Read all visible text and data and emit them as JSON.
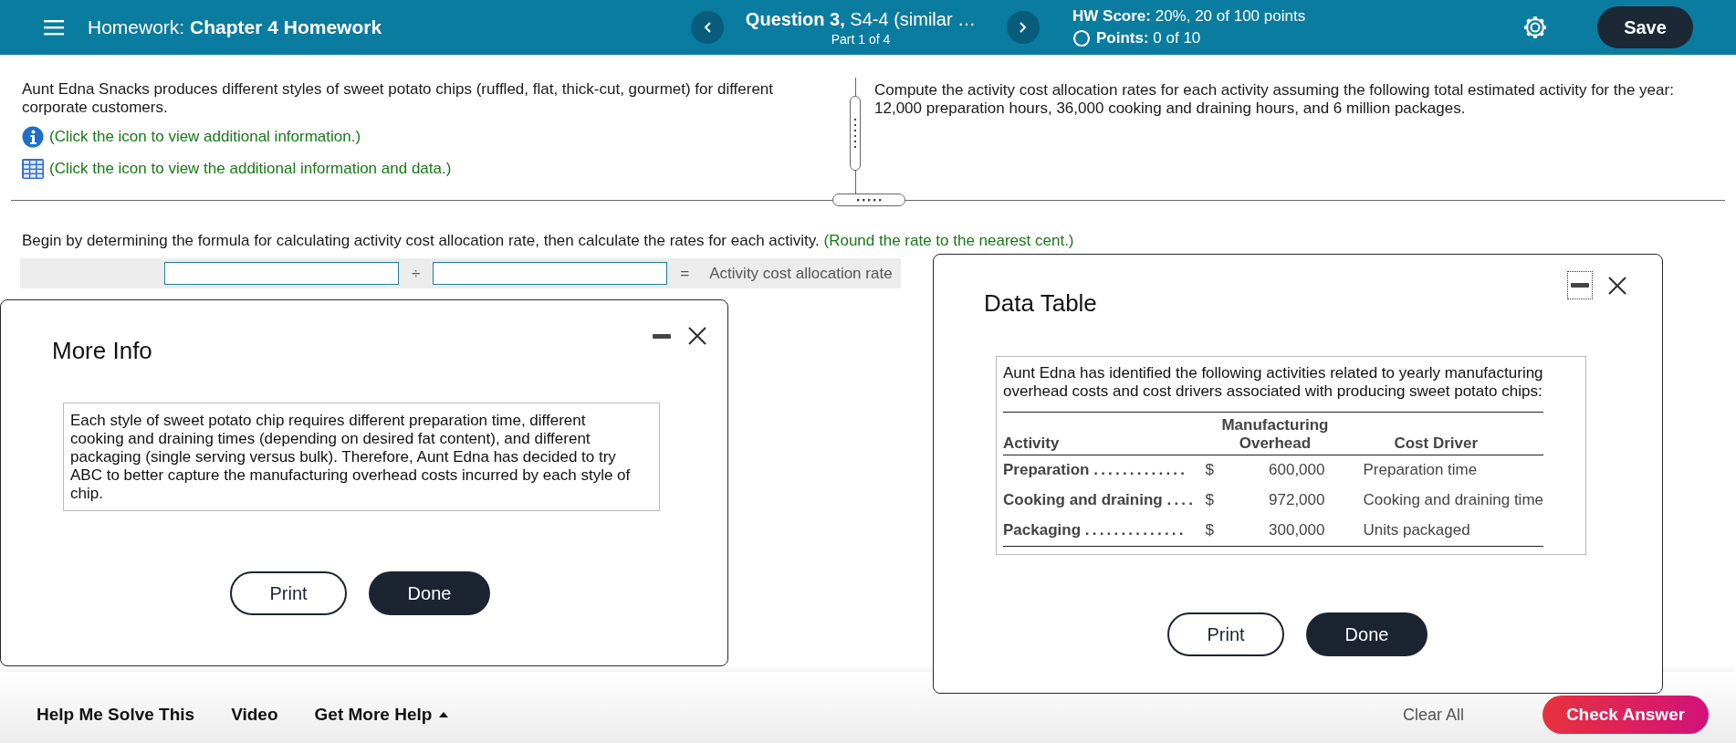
{
  "header": {
    "title_prefix": "Homework:",
    "title": "Chapter 4 Homework",
    "question": "**Question 3,** S4-4 (similar …",
    "part": "Part 1 of 4",
    "hw_score": "**HW Score:** 20%, 20 of 100 points",
    "points": "**Points:** 0 of 10",
    "save": "Save"
  },
  "problem": {
    "intro": "Aunt Edna Snacks produces different styles of sweet potato chips (ruffled, flat, thick-cut, gourmet) for different corporate customers.",
    "links": [
      {
        "kind": "info",
        "text": "(Click the icon to view additional information.)"
      },
      {
        "kind": "table",
        "text": "(Click the icon to view the additional information and data.)"
      }
    ],
    "right_text": "Compute the activity cost allocation rates for each activity assuming the following total estimated activity for the year: 12,000 preparation hours, 36,000 cooking and draining hours, and 6 million packages.",
    "instruction": "Begin by determining the formula for calculating activity cost allocation rate, then calculate the rates for each activity.",
    "hint": "(Round the rate to the nearest cent.)",
    "formula": [
      {
        "kind": "field"
      },
      {
        "kind": "symbol",
        "text": "÷"
      },
      {
        "kind": "field"
      },
      {
        "kind": "symbol",
        "text": "="
      },
      {
        "kind": "label",
        "text": "Activity cost allocation rate"
      }
    ]
  },
  "more_info": {
    "title": "More Info",
    "body": "Each style of sweet potato chip requires different preparation time, different cooking and draining times (depending on desired fat content), and different packaging (single serving versus bulk). Therefore, Aunt Edna has decided to try ABC to better capture the manufacturing overhead costs incurred by each style of chip.",
    "buttons": [
      "Print",
      "Done"
    ]
  },
  "data_table": {
    "title": "Data Table",
    "intro": "Aunt Edna has identified the following activities related to yearly manufacturing overhead costs and cost drivers associated with producing sweet potato chips:",
    "columns": [
      "Activity",
      "Manufacturing Overhead",
      "Cost Driver"
    ],
    "rows": [
      {
        "activity": "Preparation",
        "leader": ".............",
        "currency": "$",
        "amount": "600,000",
        "driver": "Preparation time"
      },
      {
        "activity": "Cooking and draining",
        "leader": "....",
        "currency": "$",
        "amount": "972,000",
        "driver": "Cooking and draining time"
      },
      {
        "activity": "Packaging",
        "leader": "..............",
        "currency": "$",
        "amount": "300,000",
        "driver": "Units packaged"
      }
    ],
    "buttons": [
      "Print",
      "Done"
    ]
  },
  "footer": {
    "links": [
      "Help Me Solve This",
      "Video",
      "Get More Help"
    ],
    "clear": "Clear All",
    "check": "Check Answer"
  }
}
